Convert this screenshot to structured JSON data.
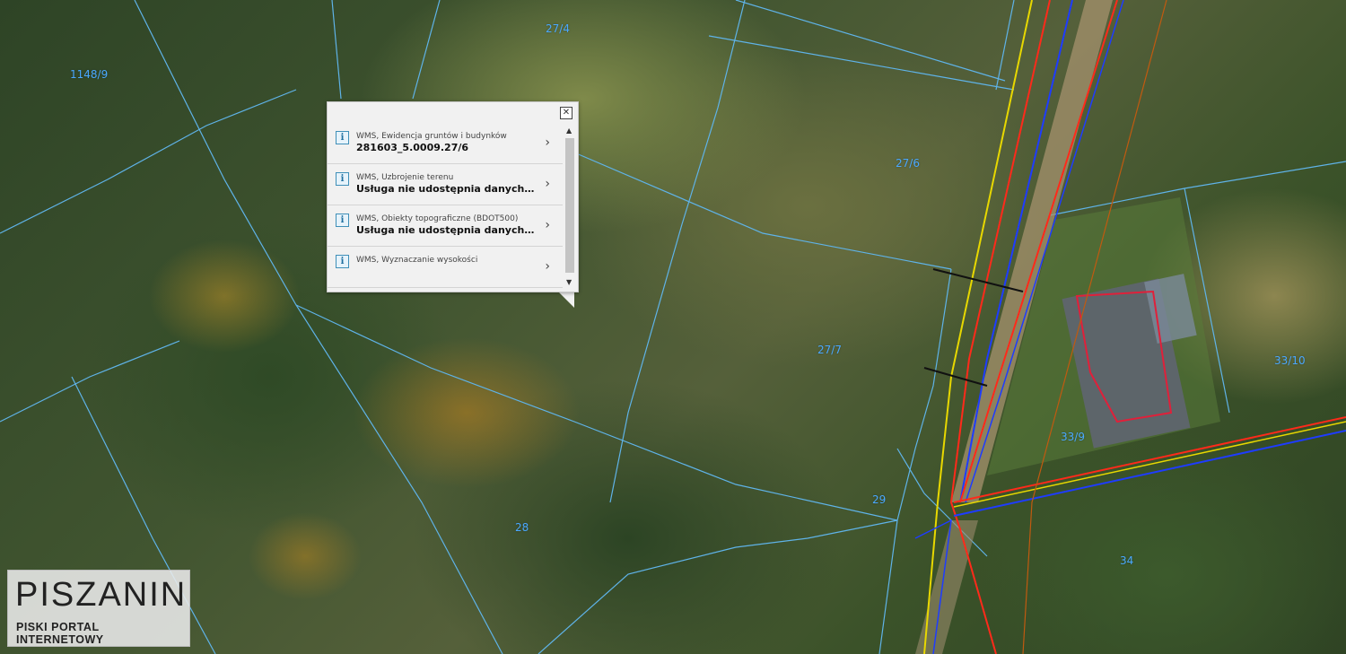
{
  "map": {
    "parcel_labels": [
      "27/4",
      "1148/9",
      "27/6",
      "27/7",
      "28",
      "29",
      "33/9",
      "33/10",
      "34"
    ],
    "colors": {
      "parcel_border": "#5fb3e8",
      "utility_red": "#ff2a1a",
      "utility_blue": "#1e3cff",
      "utility_yellow": "#e8d800",
      "utility_orange": "#c05a10",
      "building_outline": "#e0203a"
    }
  },
  "popup": {
    "close_icon": "close-icon",
    "items": [
      {
        "layer": "WMS, Ewidencja gruntów i budynków",
        "value": "281603_5.0009.27/6",
        "icon": "info-icon"
      },
      {
        "layer": "WMS, Uzbrojenie terenu",
        "value": "Usługa nie udostępnia danych opi...",
        "icon": "info-icon"
      },
      {
        "layer": "WMS, Obiekty topograficzne (BDOT500)",
        "value": "Usługa nie udostępnia danych opi...",
        "icon": "info-icon"
      },
      {
        "layer": "WMS, Wyznaczanie wysokości",
        "value": "",
        "icon": "info-icon"
      }
    ]
  },
  "logo": {
    "title": "PISZANIN",
    "subtitle": "PISKI PORTAL INTERNETOWY"
  }
}
